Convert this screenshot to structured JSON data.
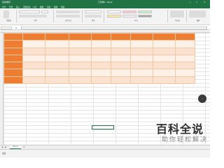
{
  "window": {
    "autosave_label": "自动保存",
    "title": "工作簿1 - Excel",
    "minimize": "—",
    "maximize": "□",
    "close": "✕"
  },
  "ribbon_tabs": [
    "文件",
    "开始",
    "插入",
    "页面布局",
    "公式",
    "数据",
    "审阅",
    "视图",
    "帮助"
  ],
  "ribbon_groups": [
    "剪贴板",
    "字体",
    "对齐方式",
    "数字",
    "样式",
    "单元格",
    "编辑"
  ],
  "formula_bar": {
    "name_box": "",
    "fx": "fx",
    "value": ""
  },
  "colors": {
    "excel_green": "#217346",
    "header_orange": "#ed7d31",
    "band_a": "#fbe2d0",
    "band_b": "#fdf1e8"
  },
  "table": {
    "headers": [
      "",
      "",
      "",
      "",
      "",
      "",
      "",
      "",
      ""
    ],
    "rows": [
      {
        "label": "",
        "cells": [
          "",
          "",
          "",
          "",
          "",
          "",
          "",
          ""
        ]
      },
      {
        "label": "",
        "cells": [
          "",
          "",
          "",
          "",
          "",
          "",
          "",
          ""
        ]
      },
      {
        "label": "",
        "cells": [
          "",
          "",
          "",
          "",
          "",
          "",
          "",
          ""
        ]
      },
      {
        "label": "",
        "cells": [
          "",
          "",
          "",
          "",
          "",
          "",
          "",
          ""
        ]
      },
      {
        "label": "",
        "cells": [
          "",
          "",
          "",
          "",
          "",
          "",
          "",
          ""
        ]
      },
      {
        "label": "",
        "cells": [
          "",
          "",
          "",
          "",
          "",
          "",
          "",
          ""
        ]
      }
    ]
  },
  "sheet_tabs": [
    "Sheet1"
  ],
  "status": {
    "ready": "就绪"
  },
  "watermark": {
    "main": "百科全说",
    "sub": "助你轻松解决"
  }
}
